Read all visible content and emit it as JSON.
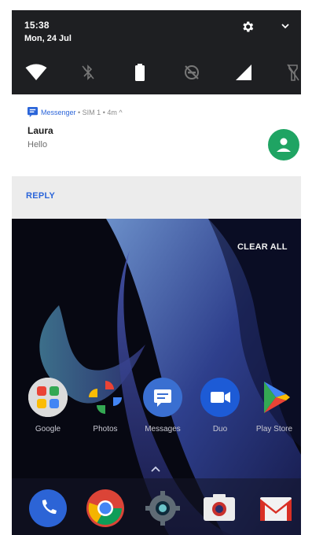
{
  "status": {
    "time": "15:38",
    "date": "Mon, 24 Jul"
  },
  "quick_tiles": [
    {
      "name": "wifi"
    },
    {
      "name": "bluetooth-off"
    },
    {
      "name": "battery"
    },
    {
      "name": "do-not-disturb-off"
    },
    {
      "name": "cellular-signal"
    },
    {
      "name": "flashlight-off"
    }
  ],
  "notification": {
    "app_name": "Messenger",
    "meta": " • SIM 1 • 4m ^",
    "title": "Laura",
    "body": "Hello",
    "action_reply": "REPLY"
  },
  "home": {
    "clear_all": "CLEAR ALL",
    "apps": [
      {
        "label": "Google"
      },
      {
        "label": "Photos"
      },
      {
        "label": "Messages"
      },
      {
        "label": "Duo"
      },
      {
        "label": "Play Store"
      }
    ],
    "dock": [
      {
        "name": "phone"
      },
      {
        "name": "chrome"
      },
      {
        "name": "settings"
      },
      {
        "name": "camera"
      },
      {
        "name": "gmail"
      }
    ]
  },
  "colors": {
    "accent": "#2b65d9",
    "avatar": "#1fa463",
    "shade": "#1e1f22"
  }
}
